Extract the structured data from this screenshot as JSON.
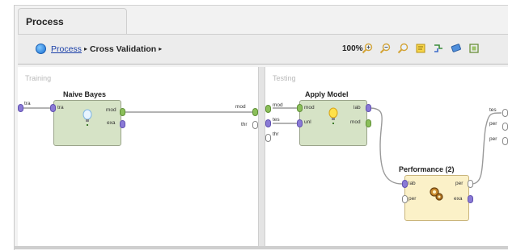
{
  "tab": {
    "label": "Process"
  },
  "breadcrumb": {
    "root": "Process",
    "current": "Cross Validation",
    "separator": "▸"
  },
  "toolbar": {
    "zoom": "100%",
    "icons": [
      "zoom-in-icon",
      "zoom-out-icon",
      "zoom-fit-icon",
      "note-icon",
      "auto-wire-icon",
      "layout-icon",
      "maximize-icon"
    ]
  },
  "panels": {
    "left": {
      "label": "Training"
    },
    "right": {
      "label": "Testing"
    }
  },
  "operators": {
    "naive_bayes": {
      "title": "Naive Bayes",
      "in": [
        "tra"
      ],
      "out": [
        "mod",
        "exa"
      ]
    },
    "apply_model": {
      "title": "Apply Model",
      "in": [
        "mod",
        "unl"
      ],
      "out": [
        "lab",
        "mod"
      ]
    },
    "performance": {
      "title": "Performance (2)",
      "in": [
        "lab",
        "per"
      ],
      "out": [
        "per",
        "exa"
      ]
    }
  },
  "ports": {
    "left_in": "tra",
    "left_out": "mod",
    "left_out2": "thr",
    "right_in1": "mod",
    "right_in2": "tes",
    "right_in3": "thr",
    "right_out1": "tes",
    "right_out2": "per",
    "right_out3": "per"
  },
  "colors": {
    "operator_green": "#d6e3c6",
    "operator_yellow": "#fbf1c8",
    "port_green": "#8bbf5a",
    "port_purple": "#8a7ad6",
    "port_white": "#ffffff",
    "wire": "#9a9a9a"
  }
}
